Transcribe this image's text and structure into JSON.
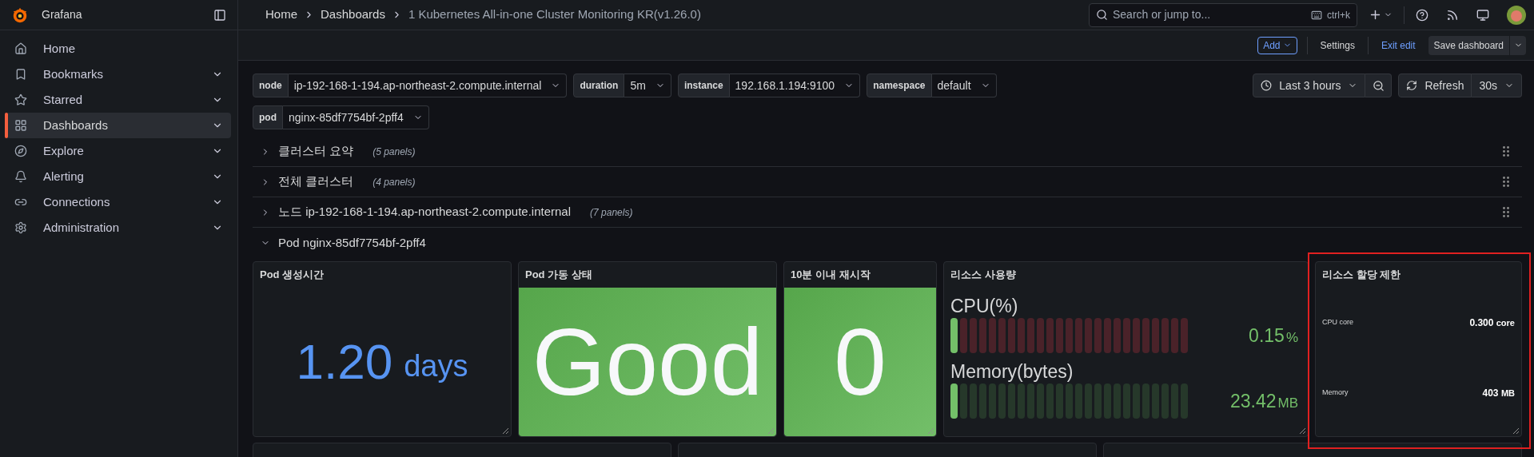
{
  "sidebar": {
    "title": "Grafana",
    "items": [
      {
        "label": "Home",
        "selected": false,
        "expandable": false
      },
      {
        "label": "Bookmarks",
        "selected": false,
        "expandable": true
      },
      {
        "label": "Starred",
        "selected": false,
        "expandable": true
      },
      {
        "label": "Dashboards",
        "selected": true,
        "expandable": true
      },
      {
        "label": "Explore",
        "selected": false,
        "expandable": true
      },
      {
        "label": "Alerting",
        "selected": false,
        "expandable": true
      },
      {
        "label": "Connections",
        "selected": false,
        "expandable": true
      },
      {
        "label": "Administration",
        "selected": false,
        "expandable": true
      }
    ]
  },
  "breadcrumbs": [
    "Home",
    "Dashboards",
    "1 Kubernetes All-in-one Cluster Monitoring KR(v1.26.0)"
  ],
  "search": {
    "placeholder": "Search or jump to...",
    "shortcut": "ctrl+k"
  },
  "toolbar": {
    "add": "Add",
    "settings": "Settings",
    "exit": "Exit edit",
    "save": "Save dashboard"
  },
  "variables": [
    {
      "name": "node",
      "value": "ip-192-168-1-194.ap-northeast-2.compute.internal"
    },
    {
      "name": "duration",
      "value": "5m"
    },
    {
      "name": "instance",
      "value": "192.168.1.194:9100"
    },
    {
      "name": "namespace",
      "value": "default"
    },
    {
      "name": "pod",
      "value": "nginx-85df7754bf-2pff4"
    }
  ],
  "time": {
    "range": "Last 3 hours",
    "refresh": "Refresh",
    "interval": "30s"
  },
  "rows": [
    {
      "title": "클러스터 요약",
      "count": "(5 panels)",
      "expanded": false
    },
    {
      "title": "전체 클러스터",
      "count": "(4 panels)",
      "expanded": false
    },
    {
      "title": "노드 ip-192-168-1-194.ap-northeast-2.compute.internal",
      "count": "(7 panels)",
      "expanded": false
    },
    {
      "title": "Pod nginx-85df7754bf-2pff4",
      "expanded": true
    }
  ],
  "panels": [
    {
      "kind": "stat_text",
      "title": "Pod 생성시간",
      "value": "1.20",
      "unit": "days",
      "color": "#5794f2",
      "highlighted": false
    },
    {
      "kind": "stat_fill",
      "title": "Pod 가동 상태",
      "value": "Good",
      "color": "#56a64b",
      "highlighted": false
    },
    {
      "kind": "stat_fill",
      "title": "10분 이내 재시작",
      "value": "0",
      "color": "#56a64b",
      "highlighted": false
    },
    {
      "kind": "bargauge",
      "title": "리소스 사용량",
      "highlighted": false,
      "gauges": [
        {
          "label": "CPU(%)",
          "value": "0.15",
          "unit": "%",
          "level": 0.04,
          "color": "#4a2229"
        },
        {
          "label": "Memory(bytes)",
          "value": "23.42",
          "unit": "MB",
          "level": 0.04,
          "color": "#26382a"
        }
      ]
    },
    {
      "kind": "list",
      "title": "리소스 할당 제한",
      "highlighted": true,
      "items": [
        {
          "label": "CPU core",
          "value": "0.300",
          "unit": "core"
        },
        {
          "label": "Memory",
          "value": "403",
          "unit": "MB"
        }
      ]
    }
  ]
}
